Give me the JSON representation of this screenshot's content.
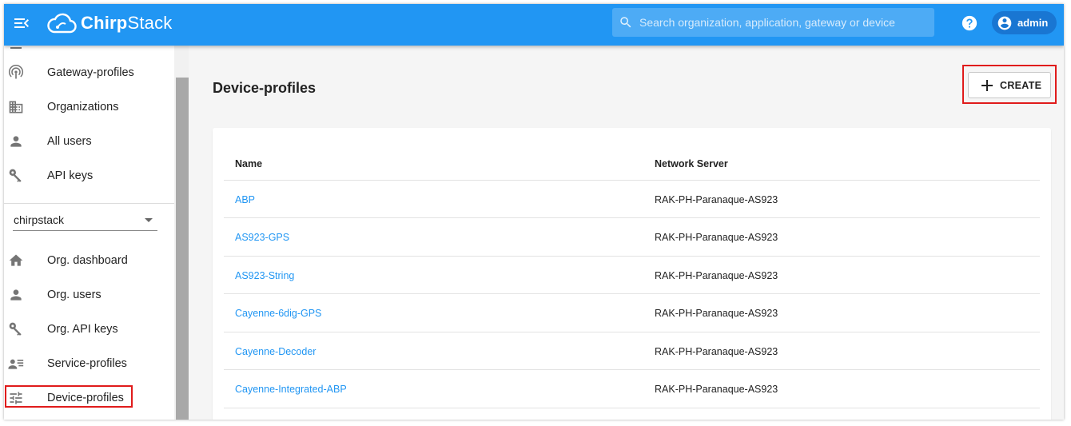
{
  "app": {
    "logo_bold": "Chirp",
    "logo_rest": "Stack"
  },
  "search": {
    "placeholder": "Search organization, application, gateway or device"
  },
  "user": {
    "name": "admin"
  },
  "sidebar": {
    "admin_items": [
      {
        "label": "Gateway-profiles",
        "icon": "gateway-icon"
      },
      {
        "label": "Organizations",
        "icon": "building-icon"
      },
      {
        "label": "All users",
        "icon": "person-icon"
      },
      {
        "label": "API keys",
        "icon": "key-icon"
      }
    ],
    "org_selector": {
      "value": "chirpstack"
    },
    "org_items": [
      {
        "label": "Org. dashboard",
        "icon": "home-icon"
      },
      {
        "label": "Org. users",
        "icon": "person-icon"
      },
      {
        "label": "Org. API keys",
        "icon": "key-icon"
      },
      {
        "label": "Service-profiles",
        "icon": "account-details-icon"
      },
      {
        "label": "Device-profiles",
        "icon": "tune-icon"
      }
    ]
  },
  "main": {
    "title": "Device-profiles",
    "create_label": "CREATE",
    "table": {
      "headers": [
        "Name",
        "Network Server"
      ],
      "rows": [
        {
          "name": "ABP",
          "network_server": "RAK-PH-Paranaque-AS923"
        },
        {
          "name": "AS923-GPS",
          "network_server": "RAK-PH-Paranaque-AS923"
        },
        {
          "name": "AS923-String",
          "network_server": "RAK-PH-Paranaque-AS923"
        },
        {
          "name": "Cayenne-6dig-GPS",
          "network_server": "RAK-PH-Paranaque-AS923"
        },
        {
          "name": "Cayenne-Decoder",
          "network_server": "RAK-PH-Paranaque-AS923"
        },
        {
          "name": "Cayenne-Integrated-ABP",
          "network_server": "RAK-PH-Paranaque-AS923"
        }
      ]
    }
  },
  "colors": {
    "primary": "#2196f3",
    "highlight": "#e01b1b"
  }
}
